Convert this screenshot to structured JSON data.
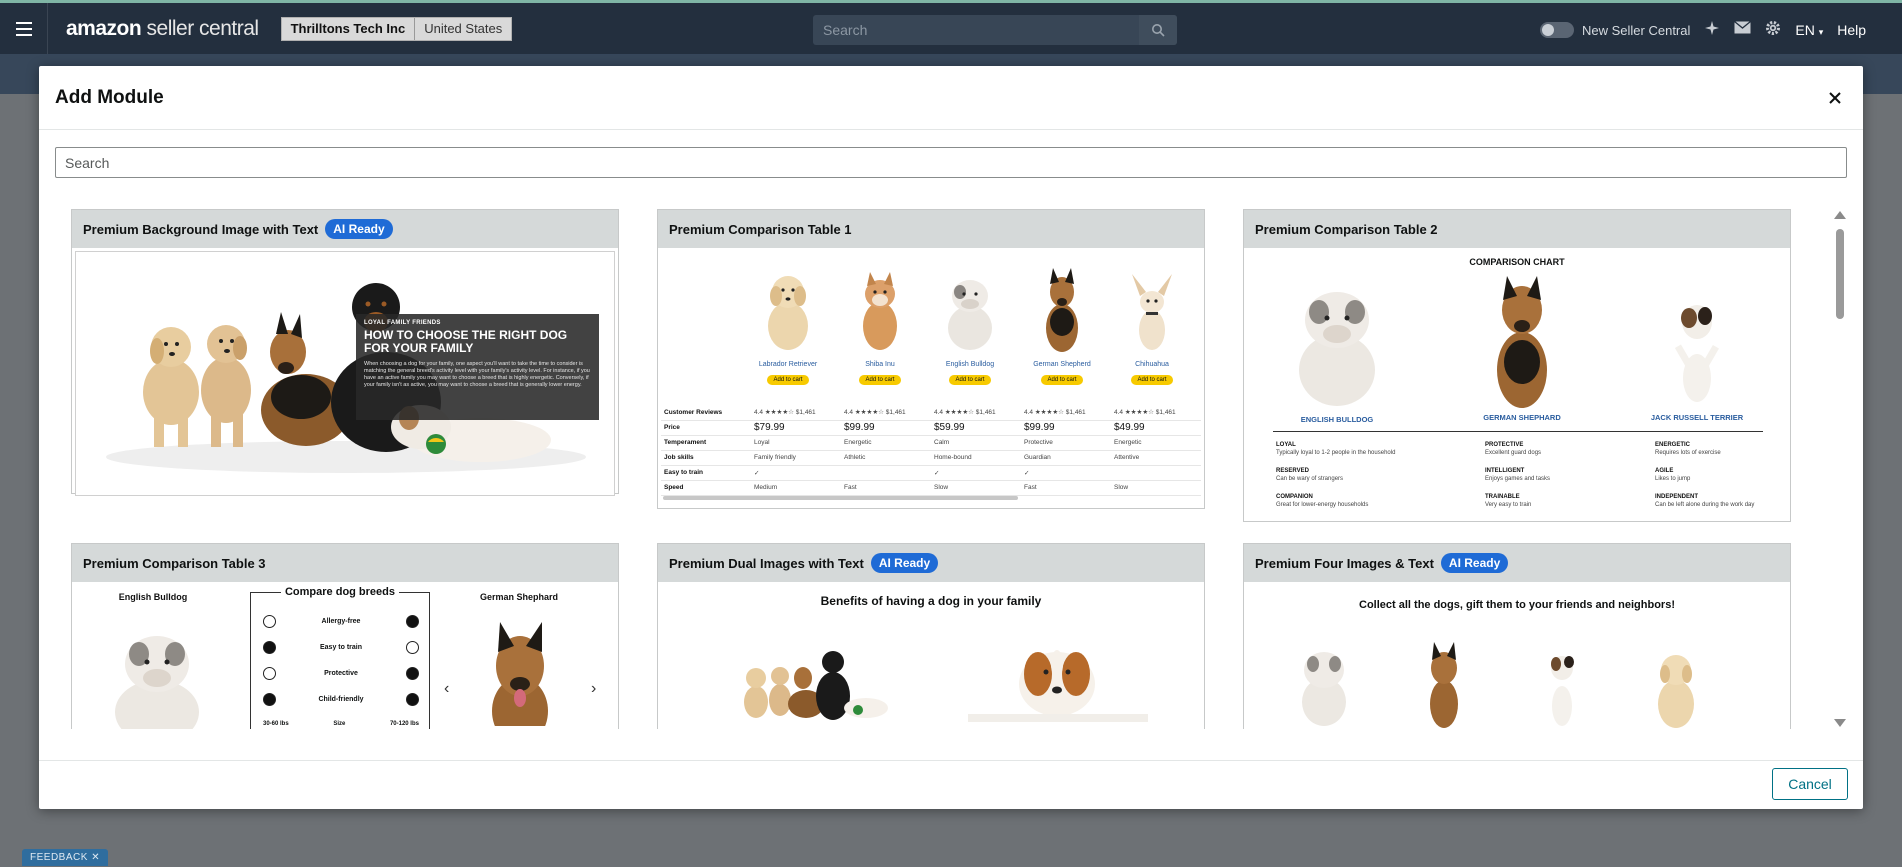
{
  "app": {
    "logo_main": "amazon",
    "logo_sub": "seller central",
    "account_name": "Thrilltons Tech Inc",
    "account_country": "United States",
    "search_placeholder": "Search",
    "new_seller_central": "New Seller Central",
    "language": "EN",
    "help": "Help",
    "feedback": "FEEDBACK"
  },
  "modal": {
    "title": "Add Module",
    "search_placeholder": "Search",
    "cancel_label": "Cancel"
  },
  "modules": [
    {
      "title": "Premium Background Image with Text",
      "badge": "AI Ready",
      "preview": {
        "kicker": "LOYAL FAMILY FRIENDS",
        "heading": "HOW TO CHOOSE THE RIGHT DOG FOR YOUR FAMILY",
        "body": "When choosing a dog for your family, one aspect you'll want to take the time to consider is matching the general breed's activity level with your family's activity level. For instance, if you have an active family you may want to choose a breed that is highly energetic. Conversely, if your family isn't as active, you may want to choose a breed that is generally lower energy."
      }
    },
    {
      "title": "Premium Comparison Table 1",
      "badge": "",
      "preview": {
        "add_to_cart": "Add to cart",
        "breeds": [
          "Labrador Retriever",
          "Shiba Inu",
          "English Bulldog",
          "German Shepherd",
          "Chihuahua"
        ],
        "rows": [
          {
            "label": "Customer Reviews",
            "values": [
              "4.4 ★★★★☆ $1,461",
              "4.4 ★★★★☆ $1,461",
              "4.4 ★★★★☆ $1,461",
              "4.4 ★★★★☆ $1,461",
              "4.4 ★★★★☆ $1,461"
            ]
          },
          {
            "label": "Price",
            "values": [
              "$79.99",
              "$99.99",
              "$59.99",
              "$99.99",
              "$49.99"
            ]
          },
          {
            "label": "Temperament",
            "values": [
              "Loyal",
              "Energetic",
              "Calm",
              "Protective",
              "Energetic"
            ]
          },
          {
            "label": "Job skills",
            "values": [
              "Family friendly",
              "Athletic",
              "Home-bound",
              "Guardian",
              "Attentive"
            ]
          },
          {
            "label": "Easy to train",
            "values": [
              "✓",
              "",
              "✓",
              "✓",
              ""
            ]
          },
          {
            "label": "Speed",
            "values": [
              "Medium",
              "Fast",
              "Slow",
              "Fast",
              "Slow"
            ]
          }
        ]
      }
    },
    {
      "title": "Premium Comparison Table 2",
      "badge": "",
      "preview": {
        "heading": "COMPARISON CHART",
        "breeds": [
          "ENGLISH BULLDOG",
          "GERMAN SHEPHARD",
          "JACK RUSSELL TERRIER"
        ],
        "traits": [
          {
            "name": "LOYAL",
            "desc": "Typically loyal to 1-2 people in the household"
          },
          {
            "name": "PROTECTIVE",
            "desc": "Excellent guard dogs"
          },
          {
            "name": "ENERGETIC",
            "desc": "Requires lots of exercise"
          },
          {
            "name": "RESERVED",
            "desc": "Can be wary of strangers"
          },
          {
            "name": "INTELLIGENT",
            "desc": "Enjoys games and tasks"
          },
          {
            "name": "AGILE",
            "desc": "Likes to jump"
          },
          {
            "name": "COMPANION",
            "desc": "Great for lower-energy households"
          },
          {
            "name": "TRAINABLE",
            "desc": "Very easy to train"
          },
          {
            "name": "INDEPENDENT",
            "desc": "Can be left alone during the work day"
          }
        ]
      }
    },
    {
      "title": "Premium Comparison Table 3",
      "badge": "",
      "preview": {
        "left_breed": "English Bulldog",
        "right_breed": "German Shephard",
        "box_title": "Compare dog breeds",
        "features": [
          "Allergy-free",
          "Easy to train",
          "Protective",
          "Child-friendly"
        ],
        "left_fill": [
          false,
          true,
          false,
          true
        ],
        "right_fill": [
          true,
          false,
          true,
          true
        ],
        "bottom_left": "30-60 lbs",
        "bottom_mid": "Size",
        "bottom_right": "70-120 lbs",
        "prev": "‹",
        "next": "›"
      }
    },
    {
      "title": "Premium Dual Images with Text",
      "badge": "AI Ready",
      "preview": {
        "heading": "Benefits of having a dog in your family"
      }
    },
    {
      "title": "Premium Four Images & Text",
      "badge": "AI Ready",
      "preview": {
        "heading": "Collect all the dogs, gift them to your friends and neighbors!"
      }
    }
  ],
  "colors": {
    "topbar": "#232f3e",
    "badge": "#1f6bd6",
    "card_header": "#d5d9d9",
    "link_teal": "#007185",
    "add_to_cart": "#f7ca00"
  }
}
